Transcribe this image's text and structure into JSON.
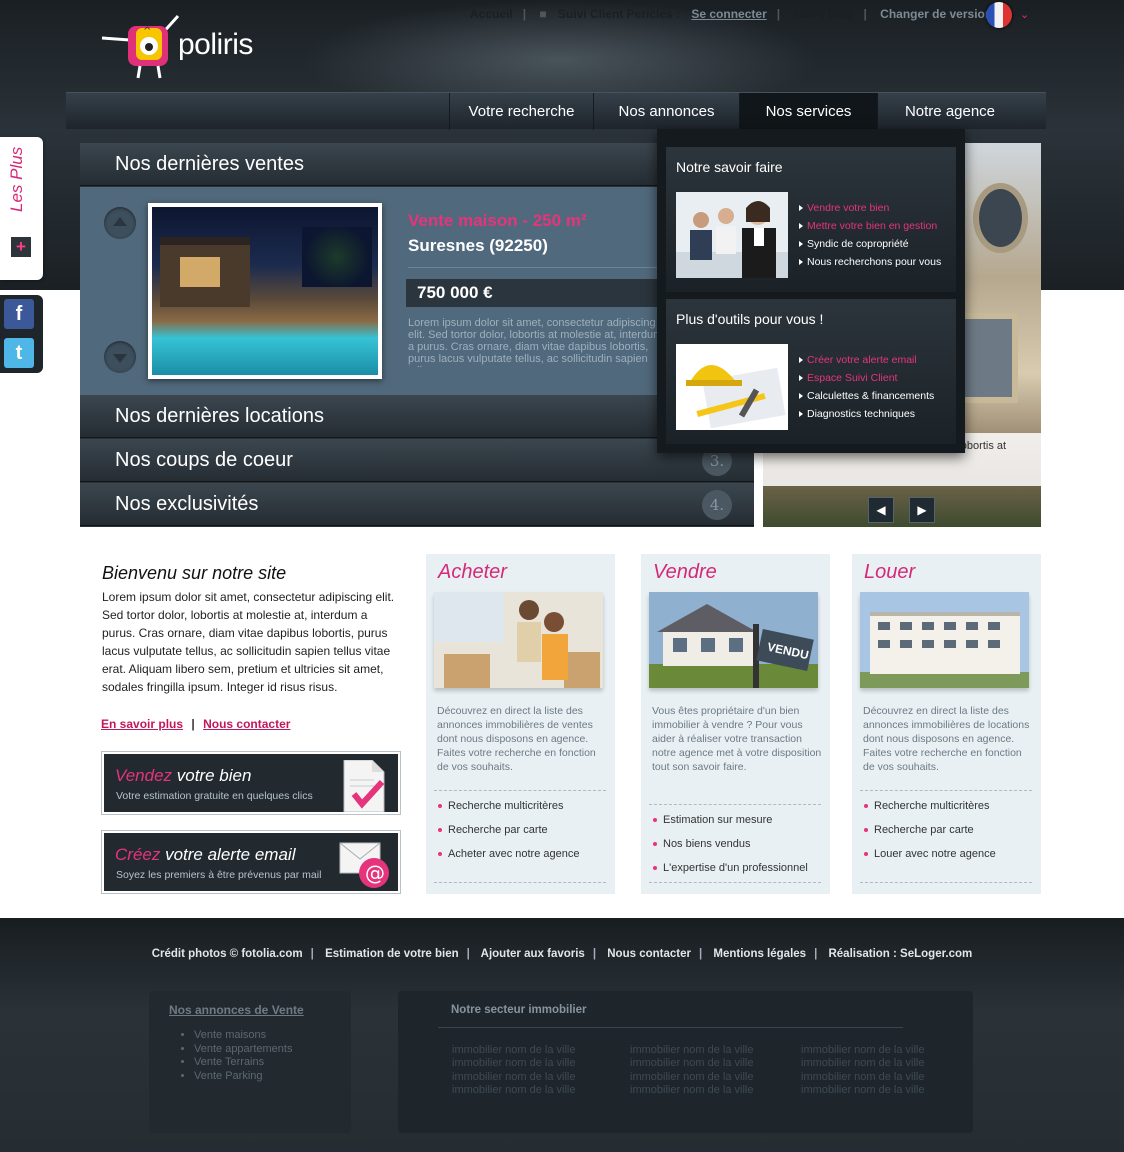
{
  "brand": {
    "name": "poliris"
  },
  "toplinks": {
    "accueil": "Accueil",
    "suivi_client": "Suivi Client Pericles :",
    "se_connecter": "Se connecter",
    "blog": "Notre blog",
    "version": "Changer de version :"
  },
  "nav": {
    "items": [
      "Votre recherche",
      "Nos annonces",
      "Nos services",
      "Notre agence"
    ],
    "active": "Nos services"
  },
  "sidebar": {
    "les_plus": "Les Plus",
    "plus_icon": "+"
  },
  "social": {
    "facebook": "f",
    "twitter": "t"
  },
  "accordion": {
    "items": [
      {
        "label": "Nos dernières ventes"
      },
      {
        "label": "Nos dernières locations"
      },
      {
        "label": "Nos coups de coeur",
        "num": "3."
      },
      {
        "label": "Nos exclusivités",
        "num": "4."
      }
    ],
    "listing": {
      "title": "Vente maison - 250 m²",
      "city": "Suresnes (92250)",
      "price": "750 000 €",
      "desc": "Lorem ipsum dolor sit amet, consectetur adipiscing elit. Sed tortor dolor, lobortis at molestie at, interdum a purus. Cras ornare, diam vitae dapibus lobortis, purus lacus vulputate tellus, ac sollicitudin sapien tellus"
    }
  },
  "photo_caption": "tur adipiscing elit. Sed tortor dolor, lobortis at",
  "dropdown": {
    "savoir": {
      "title": "Notre savoir faire",
      "items": [
        {
          "label": "Vendre votre bien",
          "pink": true
        },
        {
          "label": "Mettre votre bien en gestion",
          "pink": true
        },
        {
          "label": "Syndic de copropriété",
          "pink": false
        },
        {
          "label": "Nous recherchons pour vous",
          "pink": false
        }
      ]
    },
    "outils": {
      "title": "Plus d'outils pour vous !",
      "items": [
        {
          "label": "Créer votre alerte email",
          "pink": true
        },
        {
          "label": "Espace Suivi Client",
          "pink": true
        },
        {
          "label": "Calculettes & financements",
          "pink": false
        },
        {
          "label": "Diagnostics techniques",
          "pink": false
        }
      ]
    }
  },
  "welcome": {
    "title": "Bienvenu sur notre site",
    "text": "Lorem ipsum dolor sit amet, consectetur adipiscing elit. Sed tortor dolor, lobortis at molestie at, interdum a purus. Cras ornare, diam vitae dapibus lobortis, purus lacus vulputate tellus, ac sollicitudin sapien tellus vitae erat. Aliquam libero sem, pretium et ultricies sit amet, sodales fringilla ipsum. Integer id risus risus.",
    "link1": "En savoir plus",
    "link2": "Nous contacter",
    "sep": "|"
  },
  "promos": [
    {
      "accent": "Vendez",
      "rest": " votre bien",
      "sub": "Votre estimation gratuite en quelques clics"
    },
    {
      "accent": "Créez",
      "rest": " votre alerte email",
      "sub": "Soyez les premiers à être prévenus par mail"
    }
  ],
  "cards": {
    "acheter": {
      "title": "Acheter",
      "desc": "Découvrez en direct la liste des annonces immobilières de ventes dont nous disposons en agence. Faites votre recherche en fonction de vos souhaits.",
      "items": [
        "Recherche multicritères",
        "Recherche par carte",
        "Acheter avec notre agence"
      ]
    },
    "vendre": {
      "title": "Vendre",
      "desc": "Vous êtes propriétaire d'un bien immobilier à vendre ? Pour vous aider à réaliser votre transaction notre agence met à votre disposition tout son savoir faire.",
      "items": [
        "Estimation sur mesure",
        "Nos biens vendus",
        "L'expertise d'un professionnel"
      ],
      "sign": "VENDU"
    },
    "louer": {
      "title": "Louer",
      "desc": "Découvrez en direct la liste des annonces immobilières de locations dont nous disposons en agence. Faites votre recherche en fonction de vos souhaits.",
      "items": [
        "Recherche multicritères",
        "Recherche par carte",
        "Louer avec notre agence"
      ]
    }
  },
  "footer": {
    "links": [
      "Crédit photos © fotolia.com",
      "Estimation de votre bien",
      "Ajouter aux favoris",
      "Nous contacter",
      "Mentions légales",
      "Réalisation : SeLoger.com"
    ],
    "annonces_title": "Nos annonces de Vente",
    "annonces": [
      "Vente maisons",
      "Vente appartements",
      "Vente Terrains",
      "Vente Parking"
    ],
    "secteur_title": "Notre secteur immobilier",
    "ville": "immobilier nom de la ville"
  },
  "colors": {
    "accent": "#e6347c",
    "dark": "#1e252b",
    "card_bg": "#e8f0f4"
  }
}
